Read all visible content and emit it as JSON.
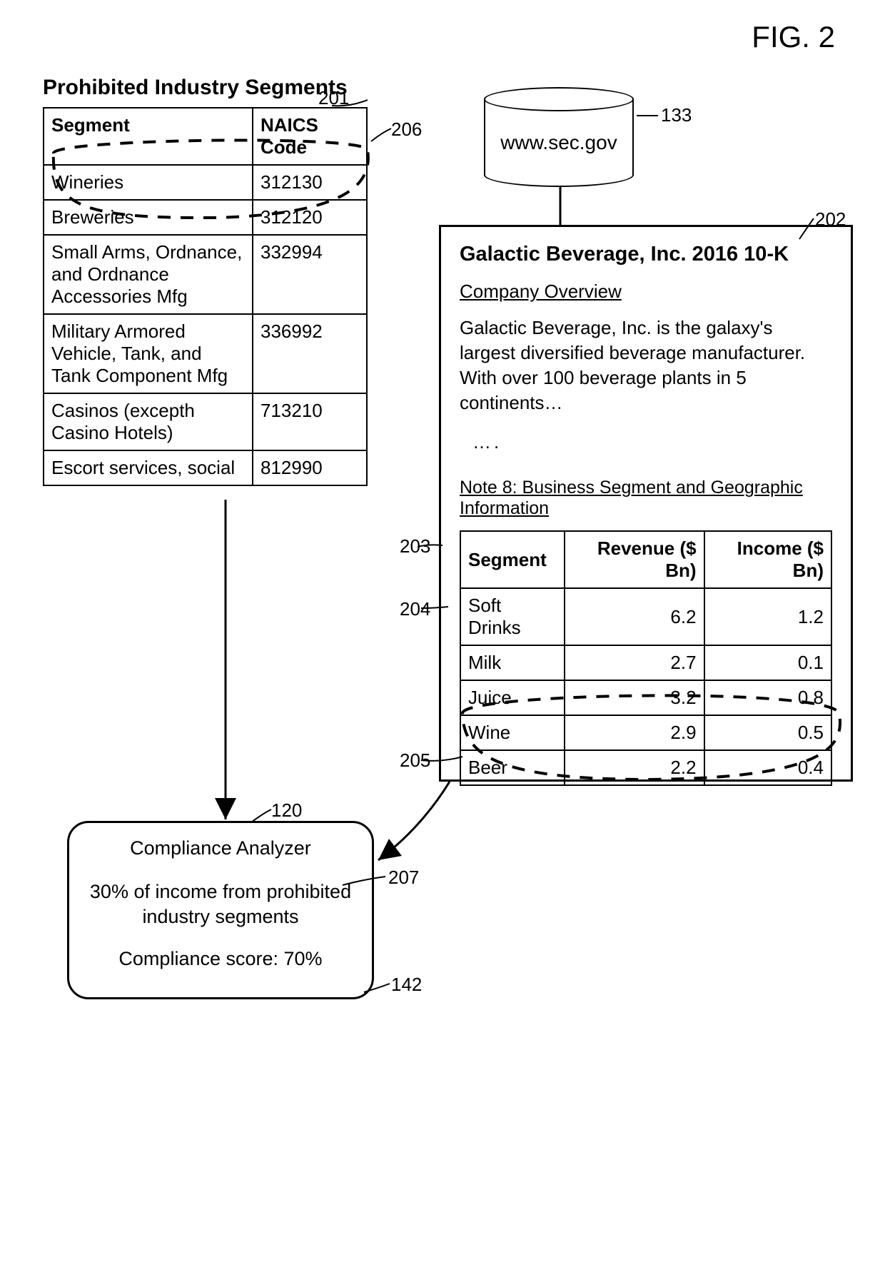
{
  "figure_label": "FIG. 2",
  "prohibited": {
    "title": "Prohibited Industry Segments",
    "headers": {
      "segment": "Segment",
      "naics": "NAICS Code"
    },
    "rows": [
      {
        "segment": "Wineries",
        "naics": "312130"
      },
      {
        "segment": "Breweries",
        "naics": "312120"
      },
      {
        "segment": "Small Arms, Ordnance, and Ordnance Accessories Mfg",
        "naics": "332994"
      },
      {
        "segment": "Military Armored Vehicle, Tank, and Tank Component Mfg",
        "naics": "336992"
      },
      {
        "segment": "Casinos (excepth Casino Hotels)",
        "naics": "713210"
      },
      {
        "segment": "Escort services, social",
        "naics": "812990"
      }
    ]
  },
  "database": {
    "label": "www.sec.gov"
  },
  "document": {
    "title": "Galactic Beverage, Inc. 2016 10-K",
    "overview_label": "Company Overview",
    "overview_text": "Galactic Beverage, Inc. is the galaxy's largest diversified beverage manufacturer. With over 100 beverage plants in 5 continents…",
    "dots": "….",
    "note8": "Note 8:  Business Segment and Geographic Information",
    "seg_headers": {
      "segment": "Segment",
      "revenue": "Revenue ($ Bn)",
      "income": "Income ($ Bn)"
    },
    "seg_rows": [
      {
        "segment": "Soft Drinks",
        "revenue": "6.2",
        "income": "1.2"
      },
      {
        "segment": "Milk",
        "revenue": "2.7",
        "income": "0.1"
      },
      {
        "segment": "Juice",
        "revenue": "3.2",
        "income": "0.8"
      },
      {
        "segment": "Wine",
        "revenue": "2.9",
        "income": "0.5"
      },
      {
        "segment": "Beer",
        "revenue": "2.2",
        "income": "0.4"
      }
    ]
  },
  "analyzer": {
    "title": "Compliance Analyzer",
    "line1": "30% of income from prohibited industry segments",
    "score": "Compliance score:  70%"
  },
  "refs": {
    "r201": "201",
    "r206": "206",
    "r133": "133",
    "r202": "202",
    "r203": "203",
    "r204": "204",
    "r205": "205",
    "r120": "120",
    "r207": "207",
    "r142": "142"
  }
}
